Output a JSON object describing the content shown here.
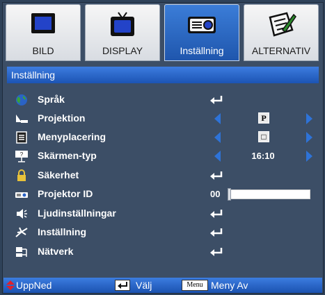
{
  "tabs": [
    {
      "label": "BILD",
      "icon": "monitor-icon",
      "active": false
    },
    {
      "label": "DISPLAY",
      "icon": "tv-icon",
      "active": false
    },
    {
      "label": "Inställning",
      "icon": "projector-icon",
      "active": true
    },
    {
      "label": "ALTERNATIV",
      "icon": "notepad-icon",
      "active": false
    }
  ],
  "section_title": "Inställning",
  "items": [
    {
      "label": "Språk",
      "icon": "globe-icon",
      "control": "enter"
    },
    {
      "label": "Projektion",
      "icon": "projection-icon",
      "control": "selector",
      "value": "P"
    },
    {
      "label": "Menyplacering",
      "icon": "menu-location-icon",
      "control": "selector",
      "value": "□"
    },
    {
      "label": "Skärmen-typ",
      "icon": "screen-type-icon",
      "control": "selector",
      "value": "16:10"
    },
    {
      "label": "Säkerhet",
      "icon": "lock-icon",
      "control": "enter"
    },
    {
      "label": "Projektor ID",
      "icon": "projector-id-icon",
      "control": "slider",
      "value": "00",
      "level": 0
    },
    {
      "label": "Ljudinställningar",
      "icon": "speaker-icon",
      "control": "enter"
    },
    {
      "label": "Inställning",
      "icon": "advanced-icon",
      "control": "enter"
    },
    {
      "label": "Nätverk",
      "icon": "network-icon",
      "control": "enter"
    }
  ],
  "footer": {
    "updown": "UppNed",
    "select": "Välj",
    "menu_key": "Menu",
    "menu_off": "Meny Av"
  },
  "colors": {
    "accent": "#1f56ad",
    "background": "#3c4e66",
    "arrow": "#2e73d8"
  }
}
